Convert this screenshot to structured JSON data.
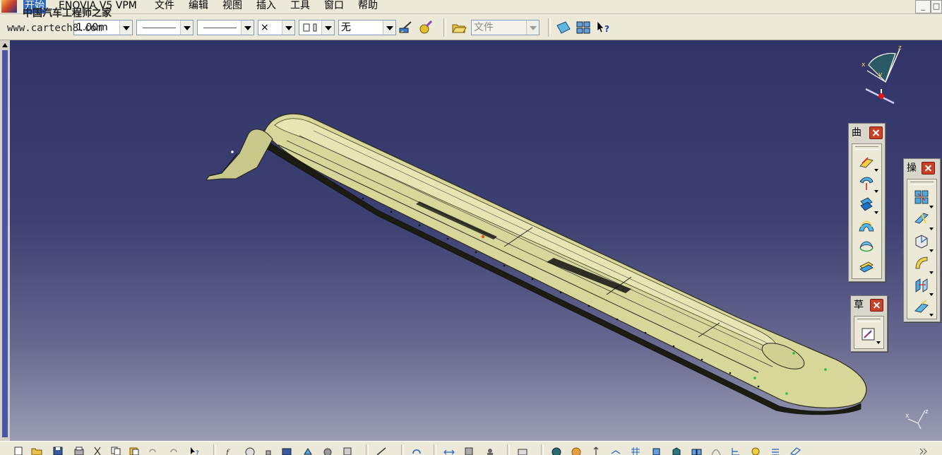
{
  "menubar": {
    "items": [
      {
        "label": "开始",
        "active": true
      },
      {
        "label": "ENOVIA V5 VPM"
      },
      {
        "label": "文件"
      },
      {
        "label": "编辑"
      },
      {
        "label": "视图"
      },
      {
        "label": "插入"
      },
      {
        "label": "工具"
      },
      {
        "label": "窗口"
      },
      {
        "label": "帮助"
      }
    ],
    "window_controls": [
      "_",
      "□"
    ]
  },
  "watermark": {
    "chinese": "中国汽车工程师之家",
    "url": "www.cartech8.com"
  },
  "toolbar": {
    "thickness_value": "1.00m",
    "line_type_value": "",
    "line_weight_value": "",
    "point_type_value": "×",
    "layer_value": "无",
    "filter_value": "文件",
    "filter_disabled": true
  },
  "palettes": {
    "surfaces": {
      "title": "曲",
      "icon_count": 6
    },
    "sketcher": {
      "title": "草",
      "icon_count": 1
    },
    "operations": {
      "title": "操",
      "icon_count": 6
    }
  },
  "compass": {
    "x_label": "x",
    "y_label": "y",
    "z_label": "z"
  },
  "triad": {
    "x_label": "x",
    "z_label": "z"
  },
  "colors": {
    "viewport_top": "#303466",
    "viewport_bottom": "#9c9cb4",
    "part_fill": "#d7d79a",
    "accent_selection": "#316ac5"
  }
}
